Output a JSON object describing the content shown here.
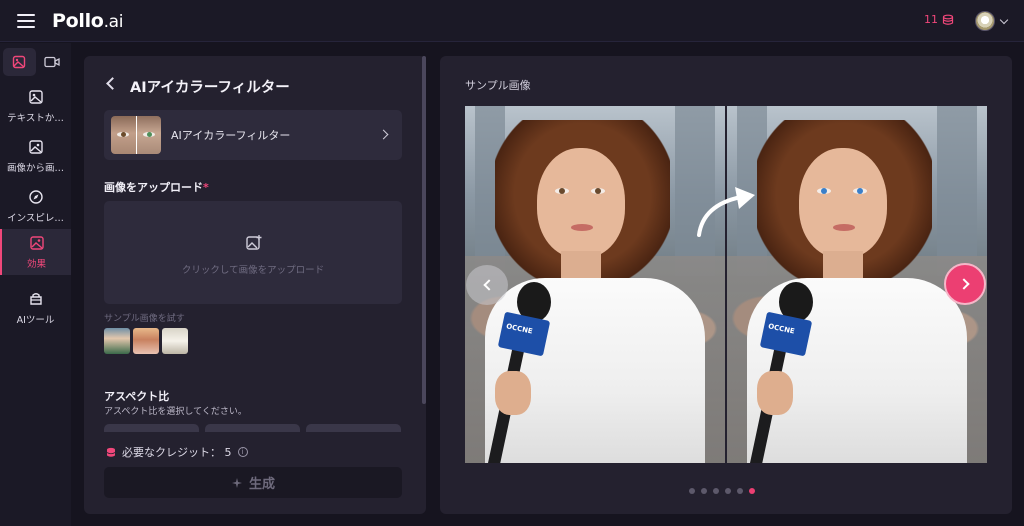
{
  "app": {
    "logo_main": "Pollo",
    "logo_suffix": ".ai"
  },
  "header": {
    "credits": "11",
    "credits_icon": "coin-icon"
  },
  "rail": {
    "toggle": [
      {
        "icon": "image-mode-icon",
        "active": true
      },
      {
        "icon": "video-mode-icon",
        "active": false
      }
    ],
    "items": [
      {
        "label": "テキストか…",
        "icon": "text-to-image-icon"
      },
      {
        "label": "画像から画…",
        "icon": "image-to-image-icon"
      },
      {
        "label": "インスピレ…",
        "icon": "compass-icon"
      },
      {
        "label": "効果",
        "icon": "effects-icon",
        "active": true
      },
      {
        "label": "AIツール",
        "icon": "ai-tools-icon"
      }
    ]
  },
  "left_panel": {
    "title": "AIアイカラーフィルター",
    "effect_card": {
      "name": "AIアイカラーフィルター"
    },
    "upload": {
      "label": "画像をアップロード",
      "required_mark": "*",
      "hint": "クリックして画像をアップロード"
    },
    "samples": {
      "label": "サンプル画像を試す",
      "count": 3
    },
    "aspect": {
      "title": "アスペクト比",
      "subtitle": "アスペクト比を選択してください。"
    },
    "credits_line": "必要なクレジット： 5",
    "generate_label": "生成"
  },
  "right_panel": {
    "title": "サンプル画像",
    "mic_brand": "OCCNE",
    "dots": {
      "count": 6,
      "active_index": 5
    }
  },
  "colors": {
    "accent": "#ec3f72",
    "panel": "#24212f",
    "background": "#16141f"
  }
}
